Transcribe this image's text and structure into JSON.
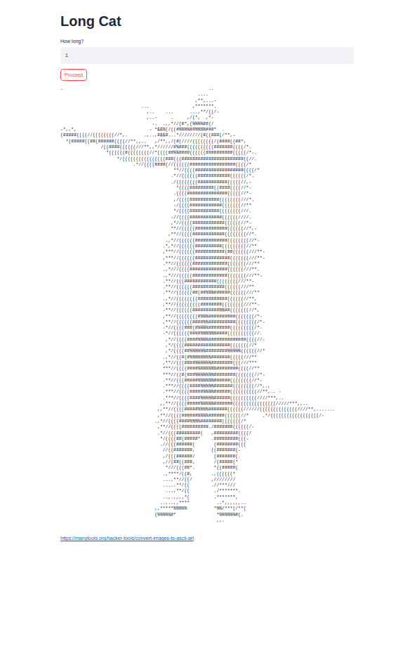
{
  "title": "Long Cat",
  "input": {
    "label": "How long?",
    "value": "1"
  },
  "button": {
    "label": "Proceed"
  },
  "ascii_art": [
    ".                                                      ..",
    "                                                   ....",
    "                                                  ,**,...-",
    "                              ...                ,*******.",
    "                                ,..    ...      ...,**/((/-",
    "                                ,..-     .     ,/(*,  ,*-",
    "                                  -.  .,,*//(#*,(%%%%##(/",
    "-*,,*,                           - *&&%(/((#%%%%##%%%%###*  .",
    "(#####((((//((((((((//*,.      .,..,#&&#...*////////(#((###(/**,-",
    "  *(#####((##(######((((//**,,..   ,/**,,/(#(////((((((((/(####((##*,",
    "               /((####((((((///**,,*//////#%###((((((((((#######((((/*.",
    "                 *((((((#((((((((//*((((##%%####((((((##########(((((/*-.",
    "                     */((((((((((((((((###(((#######################((//.",
    "                           .*//((((####(//((((((#################((((/*",
    "                                          **//((((##################((((/*",
    "                                         .*//((((((############((((((/*.",
    "                                         ./((((((((###########(((((//,-",
    "                                           *((((#########((####((((//*-",
    "                                          .((((###############(((((//*-",
    "                                          ,/((((###########((((((((///*.",
    "                                          -/((((############(((((((//**",
    "                                          */((((###########((((((((///.",
    "                                         -//((((############((((((////.",
    "                                         ,*//((((############((((((//*-",
    "                                         **//(((((############((((((//*,-",
    "                                        ,**//((((############((((((((//*.",
    "                                       .,*//((((((############((((((((//*-",
    "                                      .*,*//((((((##########(((((((((//**",
    "                                      ,***//((((((###########(##((((((///**-",
    "                                      ,***//((((((#############(((((((///**-",
    "                                      .**//((((((#############(((((((///**",
    "                                      .,*///((((##############((((((///**.",
    "                                      .,*///(((((#############(((((((///**-",
    "                                      .**//(((############((((((((///**-",
    "                                      .**//((((((############((((((///**",
    "                                      .**//((((((##(##%%%######((((((///**",
    "                                      .,*//((((((((###########((((((//**,",
    "                                      ,**//(((((((((########((((((((///**-",
    "                                      -**//((((((##########%%##(((((((//*,",
    "                                      ,**//((((((((#%%%##########(((((((/*-",
    "                                      ,**//((((((####%%##########((((((((/*-",
    "                                      -*//((((###(#%%%%########(((((((((/*-",
    "                                      -*//((((((####%%%%%%####((((((((((//.",
    "                                       ,*//((((####%%%%##############((((//-",
    "                                       ,*/((((#################(((((((//*",
    "                                       ,*/((((##%%%%%%########%%%%%((((((//*",
    "                                      .,*//((#(#%%%%%%%%#######(((((///**",
    "                                      ,**//(((####%%%%%%########(((///***",
    "                                      ***//((((####%%%%%%%########((((//**",
    "                                      ***//((#(###%%%%%%%########(((((((//*-",
    "                                      .**//(((#####%%%%%%######((((((((//*-",
    "                                      .***//((((####%%%%%#######((((((((//*,.,",
    "                                      .***//((((#####%%%%######((((((((((//**,.. -",
    "                                      .***//((((####%%%%%######((((((((((////***,..",
    "                                     ,,**//((((#####%%%%%#######((((((((((((((((/////***,,..",
    "                                    ,,**//((((#####%%%%#######((((((//////((((((((((((((////**,.......",
    "                                    ,**//((((######%%%%######((((((//*     .*/((((((((((((((((((/-",
    "                                   .,*//((((####%%%%########(((((((/*",
    "                                    ,**//((((##########./#######((((((/-",
    "                                    .*//(((#########(   ,#########((((/",
    "                                     */((((##(#####*    .#########(((-",
    "                                     .//(((######(       (########(((",
    "                                      //((#######,      ((#######(-",
    "                                      ,/(((######/       (#######(.",
    "                                      ,//(##((###,       /(#####(*",
    "                                       *///(((##*.       *((#####(",
    "                                      .,****/((#,       .,((((((*",
    "                                      ...,**//((/       ,////////",
    "                                      .....**/((        .//***///",
    "                                       ...,**/((         ./*******.",
    "                                      ..,.,,,,*(         .*******,",
    "                                     ..,..,,****          ..*,,,,,,..",
    "                                   ,,*****%%%%%          *%%/***(/**(",
    "                                   (%%%%%#*               *%%%%%%#(.",
    "                                                          ,,."
  ],
  "link": {
    "text": "https://manytools.org/hacker-tools/convert-images-to-ascii-art"
  }
}
